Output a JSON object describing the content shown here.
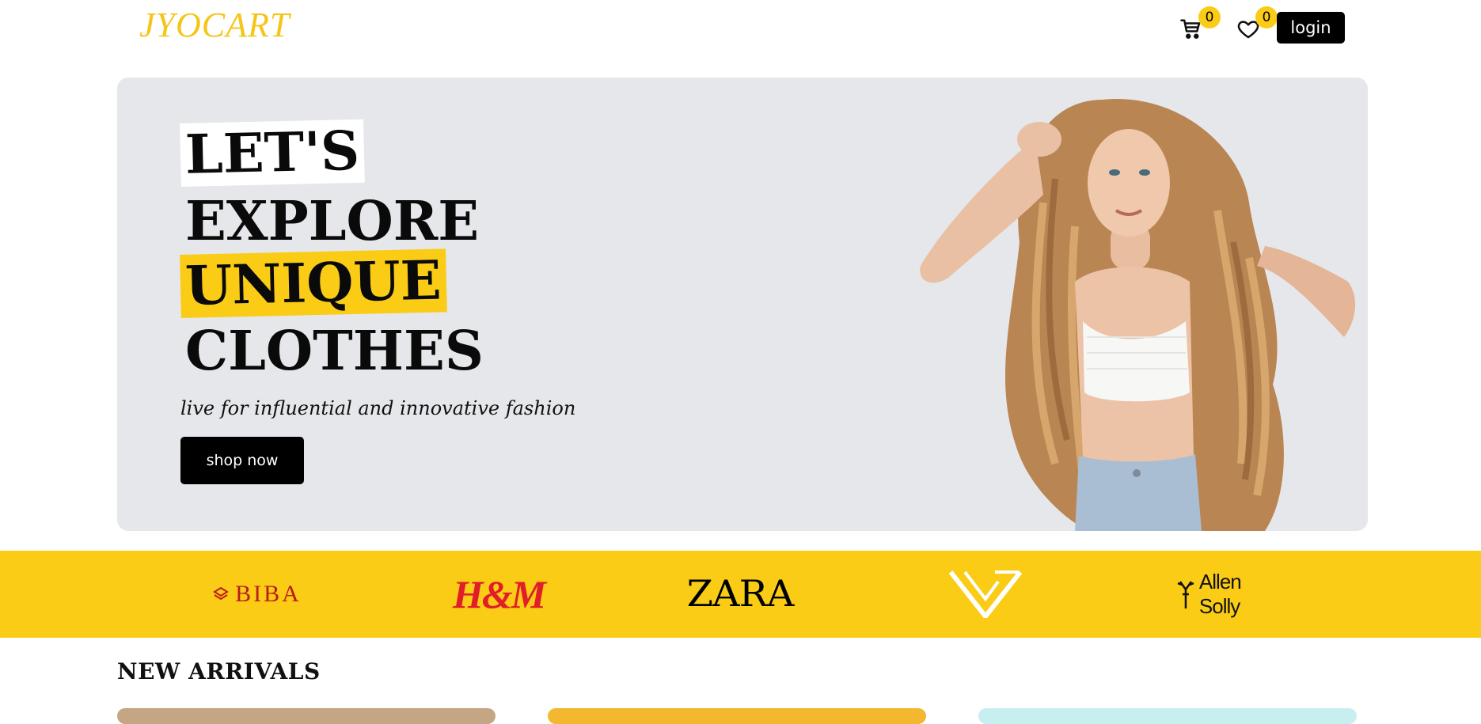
{
  "header": {
    "logo": "JYOCART",
    "cart_count": "0",
    "wishlist_count": "0",
    "login_label": "login",
    "icons": [
      "cart-icon",
      "heart-icon"
    ]
  },
  "hero": {
    "line1": "LET'S",
    "line2": "EXPLORE",
    "line3": "UNIQUE",
    "line4": "CLOTHES",
    "tagline": "live for influential and innovative fashion",
    "cta_label": "shop now",
    "background": "#e5e7eb",
    "highlight_color": "#facc15"
  },
  "brands": {
    "background": "#facc15",
    "items": [
      {
        "name": "BIBA",
        "text": "BIBA"
      },
      {
        "name": "H&M",
        "text": "H&M"
      },
      {
        "name": "ZARA",
        "text": "ZARA"
      },
      {
        "name": "Van Heusen",
        "text": ""
      },
      {
        "name": "Allen Solly",
        "text": "Allen Solly"
      }
    ]
  },
  "new_arrivals": {
    "title": "NEW ARRIVALS",
    "card_colors": [
      "#c4a584",
      "#f3b82f",
      "#c8eff0"
    ]
  }
}
